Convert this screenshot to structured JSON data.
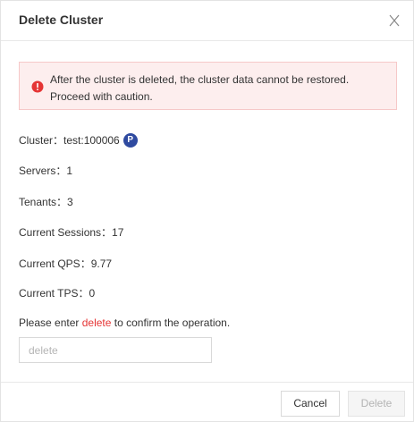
{
  "dialog": {
    "title": "Delete Cluster"
  },
  "alert": {
    "message": "After the cluster is deleted, the cluster data cannot be restored. Proceed with caution."
  },
  "details": {
    "cluster_label": "Cluster：",
    "cluster_value": "test:100006",
    "cluster_badge": "P",
    "servers_label": "Servers：",
    "servers_value": "1",
    "tenants_label": "Tenants：",
    "tenants_value": "3",
    "sessions_label": "Current Sessions：",
    "sessions_value": "17",
    "qps_label": "Current QPS：",
    "qps_value": "9.77",
    "tps_label": "Current TPS：",
    "tps_value": "0"
  },
  "confirm": {
    "prefix": "Please enter ",
    "keyword": "delete",
    "suffix": " to confirm the operation.",
    "placeholder": "delete",
    "value": ""
  },
  "footer": {
    "cancel_label": "Cancel",
    "delete_label": "Delete"
  },
  "colors": {
    "alert_bg": "#fdeeee",
    "alert_icon": "#e53535",
    "keyword": "#e53535",
    "badge": "#2f4aa0"
  },
  "icons": {
    "close": "close-icon",
    "alert": "error-circle-icon"
  }
}
